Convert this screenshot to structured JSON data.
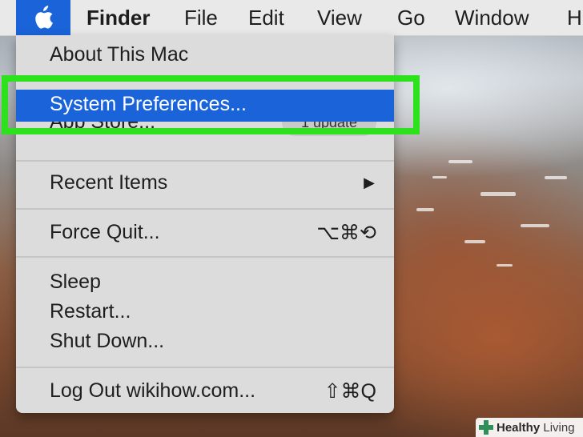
{
  "menubar": {
    "items": [
      "Finder",
      "File",
      "Edit",
      "View",
      "Go",
      "Window",
      "H"
    ]
  },
  "apple_menu": {
    "about": "About This Mac",
    "system_prefs": "System Preferences...",
    "app_store": "App Store...",
    "app_store_badge": "1 update",
    "recent": "Recent Items",
    "recent_arrow": "▶",
    "force_quit": "Force Quit...",
    "force_quit_shortcut": "⌥⌘⟲",
    "sleep": "Sleep",
    "restart": "Restart...",
    "shutdown": "Shut Down...",
    "logout": "Log Out wikihow.com...",
    "logout_shortcut": "⇧⌘Q"
  },
  "watermark": {
    "brand": "Healthy",
    "suffix": " Living"
  },
  "colors": {
    "highlight": "#1a63d8",
    "annotation": "#2ee11d"
  }
}
